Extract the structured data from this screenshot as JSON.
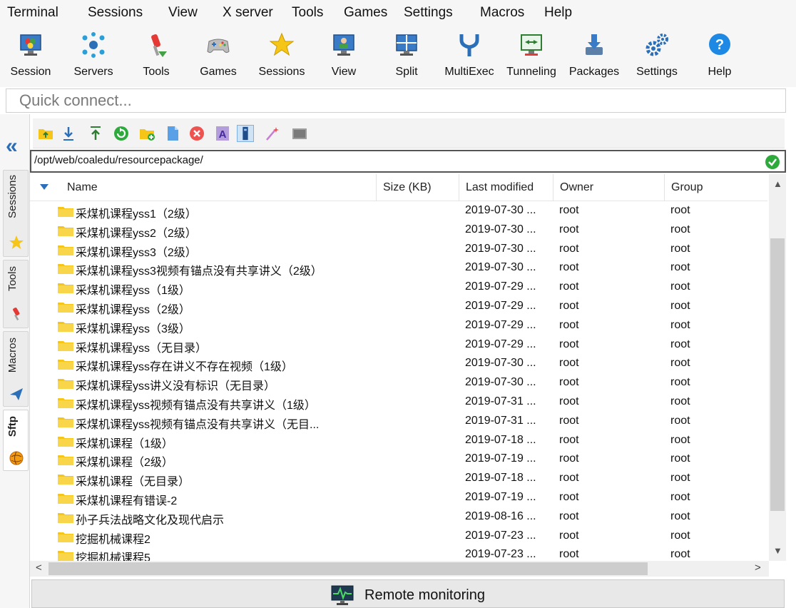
{
  "menu": [
    "Terminal",
    "Sessions",
    "View",
    "X server",
    "Tools",
    "Games",
    "Settings",
    "Macros",
    "Help"
  ],
  "toolbar": [
    {
      "label": "Session",
      "icon": "session-monitor-icon"
    },
    {
      "label": "Servers",
      "icon": "servers-network-icon"
    },
    {
      "label": "Tools",
      "icon": "tools-screwdriver-icon"
    },
    {
      "label": "Games",
      "icon": "games-gamepad-icon"
    },
    {
      "label": "Sessions",
      "icon": "star-icon"
    },
    {
      "label": "View",
      "icon": "view-monitor-icon"
    },
    {
      "label": "Split",
      "icon": "split-window-icon"
    },
    {
      "label": "MultiExec",
      "icon": "multiexec-fork-icon"
    },
    {
      "label": "Tunneling",
      "icon": "tunneling-icon"
    },
    {
      "label": "Packages",
      "icon": "packages-download-icon"
    },
    {
      "label": "Settings",
      "icon": "gears-icon"
    },
    {
      "label": "Help",
      "icon": "help-question-icon"
    }
  ],
  "quick_connect": {
    "placeholder": "Quick connect..."
  },
  "side_tabs": [
    {
      "label": "Sessions",
      "icon": "star-icon"
    },
    {
      "label": "Tools",
      "icon": "tools-screwdriver-icon"
    },
    {
      "label": "Macros",
      "icon": "macros-paperplane-icon"
    },
    {
      "label": "Sftp",
      "icon": "sftp-globe-icon"
    }
  ],
  "sftp": {
    "path": "/opt/web/coaledu/resourcepackage/",
    "columns": [
      "Name",
      "Size (KB)",
      "Last modified",
      "Owner",
      "Group"
    ],
    "rows": [
      {
        "name": "采煤机课程yss1（2级）",
        "size": "",
        "modified": "2019-07-30 ...",
        "owner": "root",
        "group": "root"
      },
      {
        "name": "采煤机课程yss2（2级）",
        "size": "",
        "modified": "2019-07-30 ...",
        "owner": "root",
        "group": "root"
      },
      {
        "name": "采煤机课程yss3（2级）",
        "size": "",
        "modified": "2019-07-30 ...",
        "owner": "root",
        "group": "root"
      },
      {
        "name": "采煤机课程yss3视频有锚点没有共享讲义（2级）",
        "size": "",
        "modified": "2019-07-30 ...",
        "owner": "root",
        "group": "root"
      },
      {
        "name": "采煤机课程yss（1级）",
        "size": "",
        "modified": "2019-07-29 ...",
        "owner": "root",
        "group": "root"
      },
      {
        "name": "采煤机课程yss（2级）",
        "size": "",
        "modified": "2019-07-29 ...",
        "owner": "root",
        "group": "root"
      },
      {
        "name": "采煤机课程yss（3级）",
        "size": "",
        "modified": "2019-07-29 ...",
        "owner": "root",
        "group": "root"
      },
      {
        "name": "采煤机课程yss（无目录）",
        "size": "",
        "modified": "2019-07-29 ...",
        "owner": "root",
        "group": "root"
      },
      {
        "name": "采煤机课程yss存在讲义不存在视频（1级）",
        "size": "",
        "modified": "2019-07-30 ...",
        "owner": "root",
        "group": "root"
      },
      {
        "name": "采煤机课程yss讲义没有标识（无目录）",
        "size": "",
        "modified": "2019-07-30 ...",
        "owner": "root",
        "group": "root"
      },
      {
        "name": "采煤机课程yss视频有锚点没有共享讲义（1级）",
        "size": "",
        "modified": "2019-07-31 ...",
        "owner": "root",
        "group": "root"
      },
      {
        "name": "采煤机课程yss视频有锚点没有共享讲义（无目...",
        "size": "",
        "modified": "2019-07-31 ...",
        "owner": "root",
        "group": "root"
      },
      {
        "name": "采煤机课程（1级）",
        "size": "",
        "modified": "2019-07-18 ...",
        "owner": "root",
        "group": "root"
      },
      {
        "name": "采煤机课程（2级）",
        "size": "",
        "modified": "2019-07-19 ...",
        "owner": "root",
        "group": "root"
      },
      {
        "name": "采煤机课程（无目录）",
        "size": "",
        "modified": "2019-07-18 ...",
        "owner": "root",
        "group": "root"
      },
      {
        "name": "采煤机课程有错误-2",
        "size": "",
        "modified": "2019-07-19 ...",
        "owner": "root",
        "group": "root"
      },
      {
        "name": "孙子兵法战略文化及现代启示",
        "size": "",
        "modified": "2019-08-16 ...",
        "owner": "root",
        "group": "root"
      },
      {
        "name": "挖掘机械课程2",
        "size": "",
        "modified": "2019-07-23 ...",
        "owner": "root",
        "group": "root"
      },
      {
        "name": "挖掘机械课程5",
        "size": "",
        "modified": "2019-07-23 ...",
        "owner": "root",
        "group": "root"
      }
    ]
  },
  "remote_monitoring": {
    "label": "Remote monitoring"
  },
  "colors": {
    "accent": "#2a6fb8",
    "folder": "#f5c518",
    "ok_green": "#2eaa3c",
    "help_blue": "#1e88e5"
  }
}
